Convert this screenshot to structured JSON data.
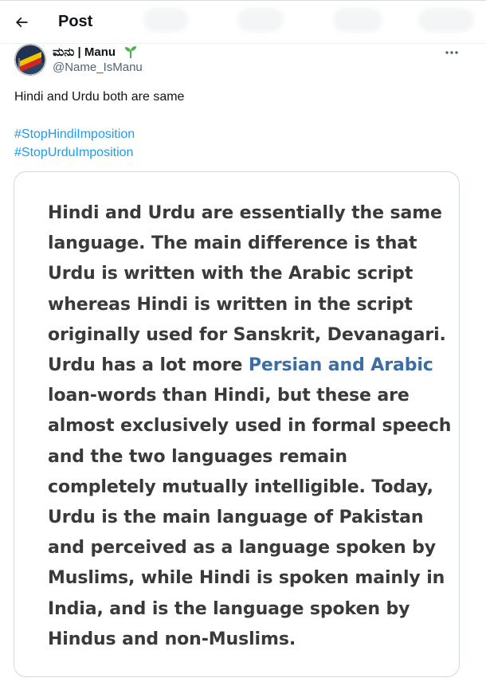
{
  "header": {
    "title": "Post",
    "back_icon": "arrow-left-icon"
  },
  "author": {
    "display_name": "ಮನು | Manu",
    "handle": "@Name_IsManu",
    "avatar_icon": "avatar-flag-icon",
    "badge_icon": "sprout-icon",
    "more_icon": "more-horizontal-icon"
  },
  "post": {
    "text": "Hindi and Urdu both are same",
    "hashtags": [
      "#StopHindiImposition",
      "#StopUrduImposition"
    ]
  },
  "media": {
    "lines": [
      {
        "pre": "Hindi and Urdu are essentially the same",
        "link": "",
        "post": ""
      },
      {
        "pre": "language. The main difference is that",
        "link": "",
        "post": ""
      },
      {
        "pre": "Urdu is written with the Arabic script",
        "link": "",
        "post": ""
      },
      {
        "pre": "whereas Hindi is written in the script",
        "link": "",
        "post": ""
      },
      {
        "pre": "originally used for Sanskrit, Devanagari.",
        "link": "",
        "post": ""
      },
      {
        "pre": "Urdu has a lot more ",
        "link": "Persian and Arabic",
        "post": ""
      },
      {
        "pre": "loan-words than Hindi, but these are",
        "link": "",
        "post": ""
      },
      {
        "pre": "almost exclusively used in formal speech",
        "link": "",
        "post": ""
      },
      {
        "pre": "and the two languages remain",
        "link": "",
        "post": ""
      },
      {
        "pre": "completely mutually intelligible. Today,",
        "link": "",
        "post": ""
      },
      {
        "pre": "Urdu is the main language of Pakistan",
        "link": "",
        "post": ""
      },
      {
        "pre": "and perceived as a language spoken by",
        "link": "",
        "post": ""
      },
      {
        "pre": "Muslims, while Hindi is spoken mainly in",
        "link": "",
        "post": ""
      },
      {
        "pre": "India, and is the language spoken by",
        "link": "",
        "post": ""
      },
      {
        "pre": "Hindus and non-Muslims.",
        "link": "",
        "post": ""
      }
    ]
  },
  "colors": {
    "accent": "#1d9bf0",
    "text": "#0f1419",
    "muted": "#536471",
    "media_text": "#3a3a3a",
    "media_link": "#3a6ea5"
  }
}
